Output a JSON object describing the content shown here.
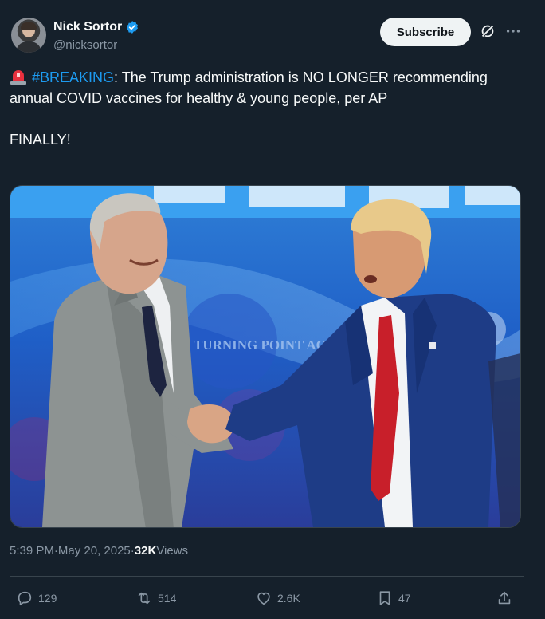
{
  "author": {
    "display_name": "Nick Sortor",
    "handle": "@nicksortor",
    "verified": true
  },
  "header": {
    "subscribe_label": "Subscribe",
    "icons": [
      "grok-icon",
      "more-icon"
    ]
  },
  "tweet": {
    "hashtag": "#BREAKING",
    "text_after_hashtag": ": The Trump administration is NO LONGER recommending annual COVID vaccines for healthy & young people, per AP",
    "text_second_paragraph": "FINALLY!",
    "emoji": "police-light-emoji",
    "media_text_banner": "TURNING POINT ACTION"
  },
  "meta": {
    "time": "5:39 PM",
    "separator": " · ",
    "date": "May 20, 2025",
    "views_count": "32K",
    "views_label": " Views"
  },
  "actions": {
    "replies": "129",
    "reposts": "514",
    "likes": "2.6K",
    "bookmarks": "47"
  },
  "colors": {
    "background": "#15202b",
    "accent": "#1d9bf0",
    "muted": "#8b98a5"
  }
}
